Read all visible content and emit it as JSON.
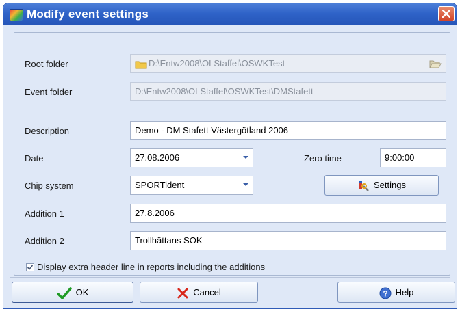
{
  "window": {
    "title": "Modify event settings"
  },
  "fields": {
    "root_folder": {
      "label": "Root folder",
      "value": "D:\\Entw2008\\OLStaffel\\OSWKTest"
    },
    "event_folder": {
      "label": "Event folder",
      "value": "D:\\Entw2008\\OLStaffel\\OSWKTest\\DMStafett"
    },
    "description": {
      "label": "Description",
      "value": "Demo - DM Stafett Västergötland 2006"
    },
    "date": {
      "label": "Date",
      "value": "27.08.2006"
    },
    "zero_time": {
      "label": "Zero time",
      "value": "9:00:00"
    },
    "chip_system": {
      "label": "Chip system",
      "value": "SPORTident"
    },
    "addition1": {
      "label": "Addition 1",
      "value": "27.8.2006"
    },
    "addition2": {
      "label": "Addition 2",
      "value": "Trollhättans SOK"
    }
  },
  "settings_button": {
    "label": "Settings"
  },
  "checkbox": {
    "label": "Display extra header line in reports including the additions",
    "checked": true
  },
  "buttons": {
    "ok": "OK",
    "cancel": "Cancel",
    "help": "Help"
  },
  "icons": {
    "app": "app-icon",
    "close": "close-icon",
    "folder": "folder-icon",
    "browse": "folder-open-icon",
    "settings": "tools-icon",
    "ok": "checkmark-icon",
    "cancel": "x-icon",
    "help": "help-icon"
  },
  "colors": {
    "titlebar": "#2f63c8",
    "dialog_bg": "#dfe8f7",
    "close_button": "#d2452a",
    "ok_check": "#1f9a25",
    "cancel_x": "#d8271a"
  }
}
